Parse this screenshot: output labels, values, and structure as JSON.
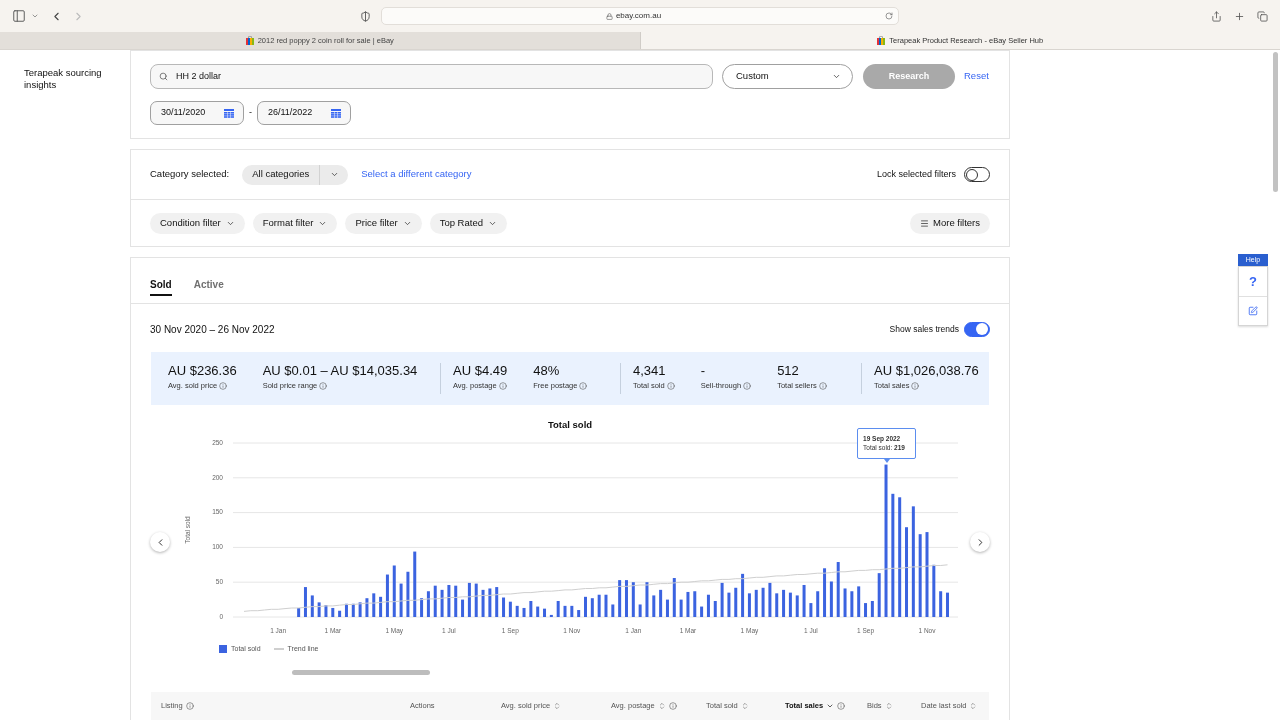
{
  "browser": {
    "url": "ebay.com.au",
    "tabs": [
      {
        "title": "2012 red poppy 2 coin roll for sale | eBay",
        "selected": false
      },
      {
        "title": "Terapeak Product Research - eBay Seller Hub",
        "selected": true
      }
    ]
  },
  "sidebar": {
    "title": "Terapeak sourcing insights"
  },
  "search": {
    "query": "HH 2 dollar",
    "period": "Custom",
    "research_button": {
      "label": "Research",
      "disabled": true
    },
    "reset": "Reset",
    "date_from": "30/11/2020",
    "date_separator": "-",
    "date_to": "26/11/2022"
  },
  "category": {
    "label": "Category selected:",
    "value": "All categories",
    "change_link": "Select a different category",
    "lock_label": "Lock selected filters",
    "lock_on": false
  },
  "filters": [
    "Condition filter",
    "Format filter",
    "Price filter",
    "Top Rated"
  ],
  "more_filters": "More filters",
  "results": {
    "tabs": [
      {
        "label": "Sold",
        "selected": true
      },
      {
        "label": "Active",
        "selected": false
      }
    ],
    "date_range": "30 Nov 2020 – 26 Nov 2022",
    "trends_label": "Show sales trends",
    "trends_on": true,
    "stat_groups": [
      {
        "stats": [
          {
            "value": "AU $236.36",
            "label": "Avg. sold price"
          },
          {
            "value": "AU $0.01 – AU $14,035.34",
            "label": "Sold price range"
          }
        ]
      },
      {
        "stats": [
          {
            "value": "AU $4.49",
            "label": "Avg. postage"
          },
          {
            "value": "48%",
            "label": "Free postage"
          }
        ]
      },
      {
        "stats": [
          {
            "value": "4,341",
            "label": "Total sold"
          },
          {
            "value": "-",
            "label": "Sell-through"
          },
          {
            "value": "512",
            "label": "Total sellers"
          }
        ]
      },
      {
        "stats": [
          {
            "value": "AU $1,026,038.76",
            "label": "Total sales"
          }
        ]
      }
    ],
    "chart": {
      "chart_data": {
        "type": "bar",
        "title": "Total sold",
        "ylabel": "Total sold",
        "categories": [
          null,
          null,
          null,
          null,
          null,
          "1 Jan",
          null,
          null,
          null,
          null,
          null,
          null,
          null,
          "1 Mar",
          null,
          null,
          null,
          null,
          null,
          null,
          null,
          null,
          "1 May",
          null,
          null,
          null,
          null,
          null,
          null,
          null,
          "1 Jul",
          null,
          null,
          null,
          null,
          null,
          null,
          null,
          null,
          "1 Sep",
          null,
          null,
          null,
          null,
          null,
          null,
          null,
          null,
          "1 Nov",
          null,
          null,
          null,
          null,
          null,
          null,
          null,
          null,
          "1 Jan",
          null,
          null,
          null,
          null,
          null,
          null,
          null,
          "1 Mar",
          null,
          null,
          null,
          null,
          null,
          null,
          null,
          null,
          "1 May",
          null,
          null,
          null,
          null,
          null,
          null,
          null,
          null,
          "1 Jul",
          null,
          null,
          null,
          null,
          null,
          null,
          null,
          "1 Sep",
          null,
          null,
          null,
          null,
          null,
          null,
          null,
          null,
          "1 Nov",
          null,
          null,
          null
        ],
        "ylim": [
          0,
          250
        ],
        "yticks": [
          0,
          50,
          100,
          150,
          200,
          250
        ],
        "grid": true,
        "legend": "bottom-left",
        "series": [
          {
            "name": "Total sold",
            "color": "#3b63e0",
            "values": [
              0,
              0,
              0,
              0,
              0,
              0,
              0,
              0,
              13,
              43,
              31,
              21,
              17,
              13,
              9,
              19,
              19,
              21,
              27,
              34,
              29,
              61,
              74,
              48,
              65,
              94,
              27,
              37,
              45,
              39,
              46,
              45,
              25,
              49,
              48,
              39,
              41,
              43,
              28,
              22,
              16,
              13,
              23,
              15,
              12,
              3,
              23,
              16,
              16,
              10,
              29,
              27,
              32,
              32,
              18,
              53,
              53,
              50,
              18,
              50,
              31,
              39,
              25,
              56,
              25,
              36,
              37,
              15,
              32,
              23,
              49,
              35,
              42,
              62,
              34,
              39,
              42,
              49,
              34,
              39,
              35,
              31,
              46,
              20,
              37,
              70,
              51,
              79,
              41,
              37,
              44,
              20,
              23,
              63,
              219,
              177,
              172,
              129,
              159,
              119,
              122,
              75,
              37,
              35
            ]
          },
          {
            "name": "Trend line",
            "color": "#cfcfcf",
            "type": "line",
            "values": [
              8,
              9,
              9,
              10,
              11,
              11,
              12,
              13,
              13,
              14,
              15,
              15,
              16,
              16,
              17,
              18,
              18,
              19,
              20,
              20,
              21,
              22,
              22,
              23,
              24,
              24,
              25,
              26,
              26,
              27,
              28,
              28,
              29,
              29,
              30,
              31,
              31,
              32,
              33,
              33,
              34,
              35,
              35,
              36,
              37,
              37,
              38,
              39,
              39,
              40,
              41,
              41,
              42,
              42,
              43,
              44,
              44,
              45,
              46,
              46,
              47,
              48,
              48,
              49,
              50,
              50,
              51,
              52,
              52,
              53,
              54,
              54,
              55,
              55,
              56,
              57,
              57,
              58,
              59,
              59,
              60,
              61,
              61,
              62,
              63,
              63,
              64,
              65,
              65,
              66,
              67,
              67,
              68,
              68,
              69,
              70,
              70,
              71,
              72,
              72,
              73,
              74,
              74,
              75
            ]
          }
        ],
        "annotations": [
          {
            "y": 219,
            "text": "**19 Sep 2022**\nTotal sold: **219**"
          }
        ]
      }
    },
    "table": {
      "columns": [
        {
          "label": "Listing",
          "sortable": false,
          "sorted": false,
          "info": true
        },
        {
          "label": "Actions",
          "sortable": false,
          "sorted": false,
          "info": false
        },
        {
          "label": "Avg. sold price",
          "sortable": true,
          "sorted": false,
          "info": false
        },
        {
          "label": "Avg. postage",
          "sortable": true,
          "sorted": false,
          "info": true
        },
        {
          "label": "Total sold",
          "sortable": true,
          "sorted": false,
          "info": false
        },
        {
          "label": "Total sales",
          "sortable": true,
          "sorted": true,
          "info": true
        },
        {
          "label": "Bids",
          "sortable": true,
          "sorted": false,
          "info": false
        },
        {
          "label": "Date last sold",
          "sortable": true,
          "sorted": false,
          "info": false
        }
      ]
    }
  },
  "help": {
    "label": "Help",
    "glyph": "?"
  }
}
